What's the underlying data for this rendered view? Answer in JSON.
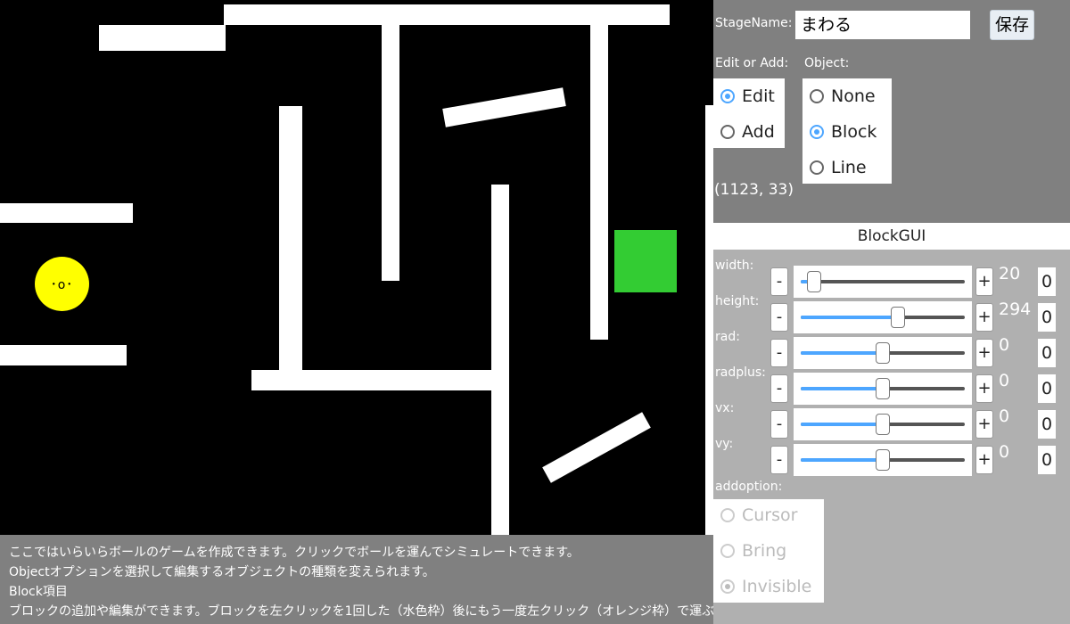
{
  "game": {
    "ball_face": "･o･",
    "goal_color": "#33cc33",
    "ball_color": "#ffff00"
  },
  "help": {
    "lines": [
      "ここではいらいらボールのゲームを作成できます。クリックでボールを運んでシミュレートできます。",
      "Objectオプションを選択して編集するオブジェクトの種類を変えられます。",
      "Block項目",
      "ブロックの追加や編集ができます。ブロックを左クリックを1回した（水色枠）後にもう一度左クリック（オレンジ枠）で運ぶことができます"
    ]
  },
  "panel": {
    "stage_label": "StageName:",
    "stage_value": "まわる",
    "save_label": "保存",
    "edit_add_label": "Edit or Add:",
    "object_label": "Object:",
    "edit_add_options": [
      "Edit",
      "Add"
    ],
    "edit_add_selected": "Edit",
    "object_options": [
      "None",
      "Block",
      "Line"
    ],
    "object_selected": "Block",
    "coords": "(1123, 33)"
  },
  "blockgui": {
    "title": "BlockGUI",
    "minus": "-",
    "plus": "+",
    "rows": [
      {
        "label": "width:",
        "value": "20",
        "box": "0",
        "level": 0.08
      },
      {
        "label": "height:",
        "value": "294",
        "box": "0",
        "level": 0.59
      },
      {
        "label": "rad:",
        "value": "0",
        "box": "0",
        "level": 0.5
      },
      {
        "label": "radplus:",
        "value": "0",
        "box": "0",
        "level": 0.5
      },
      {
        "label": "vx:",
        "value": "0",
        "box": "0",
        "level": 0.5
      },
      {
        "label": "vy:",
        "value": "0",
        "box": "0",
        "level": 0.5
      }
    ],
    "addoption_label": "addoption:",
    "addoptions": [
      "Cursor",
      "Bring",
      "Invisible"
    ],
    "addoption_selected": "Invisible"
  }
}
